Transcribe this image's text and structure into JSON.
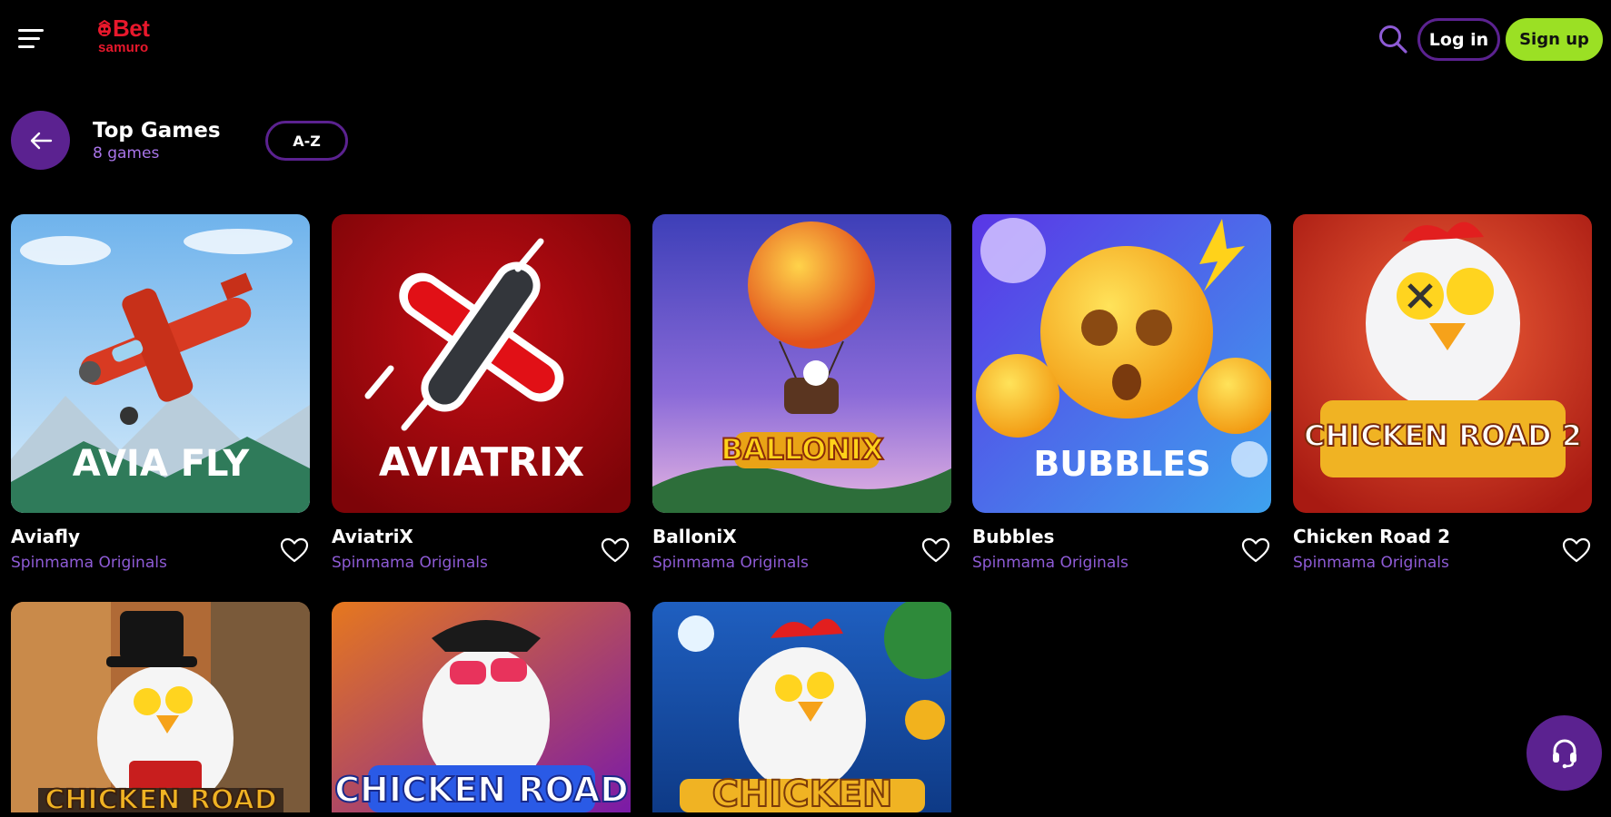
{
  "header": {
    "brand_top": "Bet",
    "brand_bottom": "samuro",
    "login_label": "Log in",
    "signup_label": "Sign up"
  },
  "section": {
    "title": "Top Games",
    "count": "8 games",
    "sort_label": "A-Z"
  },
  "games": [
    {
      "name": "Aviafly",
      "provider": "Spinmama Originals",
      "art_text": "AVIA FLY"
    },
    {
      "name": "AviatriX",
      "provider": "Spinmama Originals",
      "art_text": "AVIATRIX"
    },
    {
      "name": "BalloniX",
      "provider": "Spinmama Originals",
      "art_text": "BALLONIX"
    },
    {
      "name": "Bubbles",
      "provider": "Spinmama Originals",
      "art_text": "BUBBLES"
    },
    {
      "name": "Chicken Road 2",
      "provider": "Spinmama Originals",
      "art_text": "CHICKEN ROAD 2"
    },
    {
      "name": "",
      "provider": "",
      "art_text": "CHICKEN ROAD"
    },
    {
      "name": "",
      "provider": "",
      "art_text": "CHICKEN ROAD"
    },
    {
      "name": "",
      "provider": "",
      "art_text": "CHICKEN"
    }
  ],
  "colors": {
    "accent_purple": "#5b2290",
    "provider_text": "#8e5bd6",
    "signup_green": "#9be024",
    "brand_red": "#e8182c"
  },
  "icons": [
    "menu-icon",
    "search-icon",
    "arrow-left-icon",
    "heart-icon",
    "headset-icon"
  ]
}
